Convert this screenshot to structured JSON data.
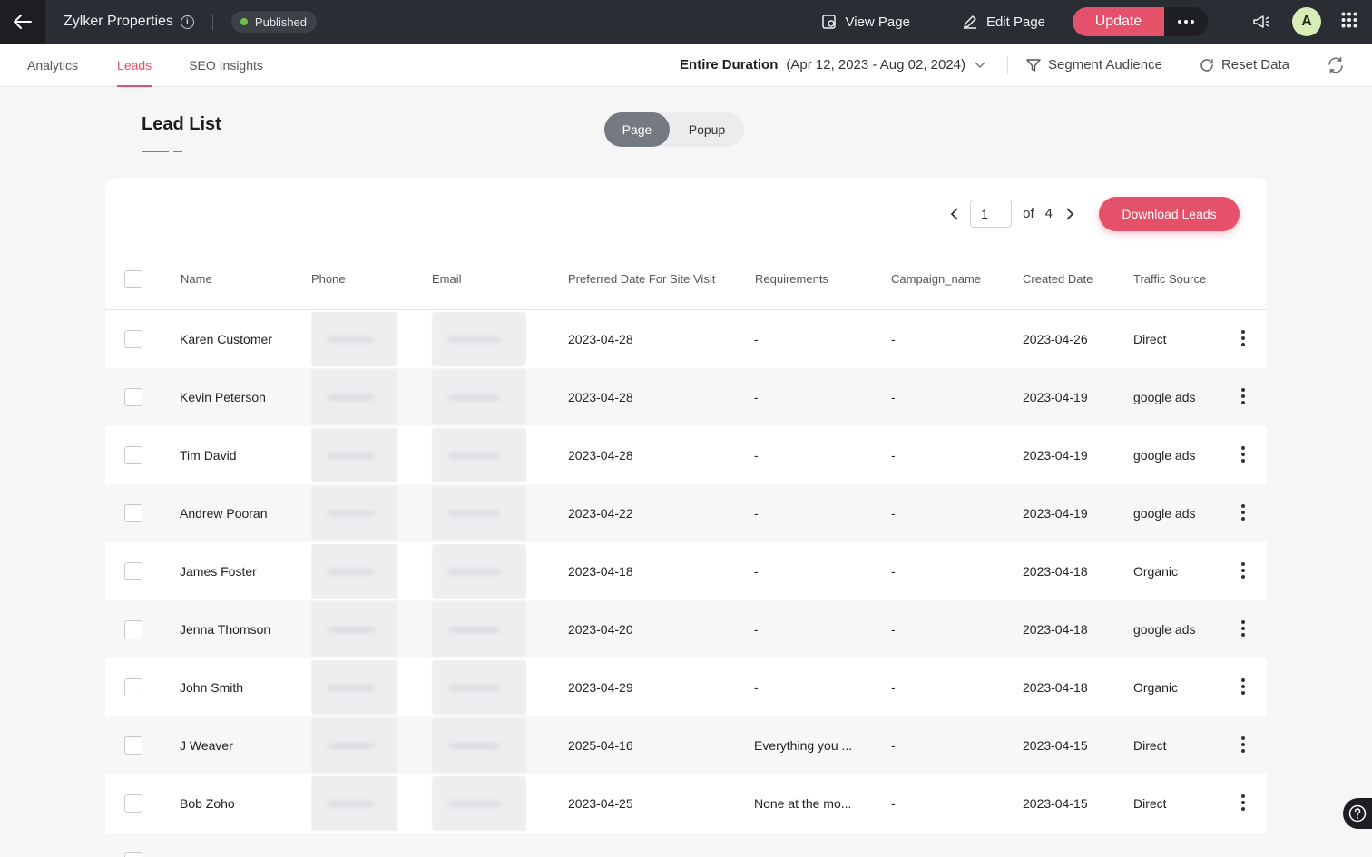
{
  "topbar": {
    "site_title": "Zylker Properties",
    "status": "Published",
    "status_color": "#6ac04a",
    "view_page": "View Page",
    "edit_page": "Edit Page",
    "update": "Update",
    "avatar_initial": "A",
    "accent": "#e5506a"
  },
  "tabs": [
    {
      "label": "Analytics",
      "active": false
    },
    {
      "label": "Leads",
      "active": true
    },
    {
      "label": "SEO Insights",
      "active": false
    }
  ],
  "filters": {
    "duration_label": "Entire Duration",
    "duration_range": "(Apr 12, 2023 - Aug 02, 2024)",
    "segment": "Segment Audience",
    "reset": "Reset Data"
  },
  "lead_list": {
    "title": "Lead List",
    "toggle": [
      "Page",
      "Popup"
    ],
    "toggle_selected": "Page",
    "pager": {
      "current": "1",
      "of": "of",
      "total": "4"
    },
    "download": "Download Leads",
    "columns": [
      "Name",
      "Phone",
      "Email",
      "Preferred Date For Site Visit",
      "Requirements",
      "Campaign_name",
      "Created Date",
      "Traffic Source"
    ],
    "rows": [
      {
        "name": "Karen Customer",
        "preferred": "2023-04-28",
        "requirements": "-",
        "campaign": "-",
        "created": "2023-04-26",
        "source": "Direct"
      },
      {
        "name": "Kevin Peterson",
        "preferred": "2023-04-28",
        "requirements": "-",
        "campaign": "-",
        "created": "2023-04-19",
        "source": "google ads"
      },
      {
        "name": "Tim David",
        "preferred": "2023-04-28",
        "requirements": "-",
        "campaign": "-",
        "created": "2023-04-19",
        "source": "google ads"
      },
      {
        "name": "Andrew Pooran",
        "preferred": "2023-04-22",
        "requirements": "-",
        "campaign": "-",
        "created": "2023-04-19",
        "source": "google ads"
      },
      {
        "name": "James Foster",
        "preferred": "2023-04-18",
        "requirements": "-",
        "campaign": "-",
        "created": "2023-04-18",
        "source": "Organic"
      },
      {
        "name": "Jenna Thomson",
        "preferred": "2023-04-20",
        "requirements": "-",
        "campaign": "-",
        "created": "2023-04-18",
        "source": "google ads"
      },
      {
        "name": "John Smith",
        "preferred": "2023-04-29",
        "requirements": "-",
        "campaign": "-",
        "created": "2023-04-18",
        "source": "Organic"
      },
      {
        "name": "J Weaver",
        "preferred": "2025-04-16",
        "requirements": "Everything you ...",
        "campaign": "-",
        "created": "2023-04-15",
        "source": "Direct"
      },
      {
        "name": "Bob Zoho",
        "preferred": "2023-04-25",
        "requirements": "None at the mo...",
        "campaign": "-",
        "created": "2023-04-15",
        "source": "Direct"
      }
    ]
  }
}
